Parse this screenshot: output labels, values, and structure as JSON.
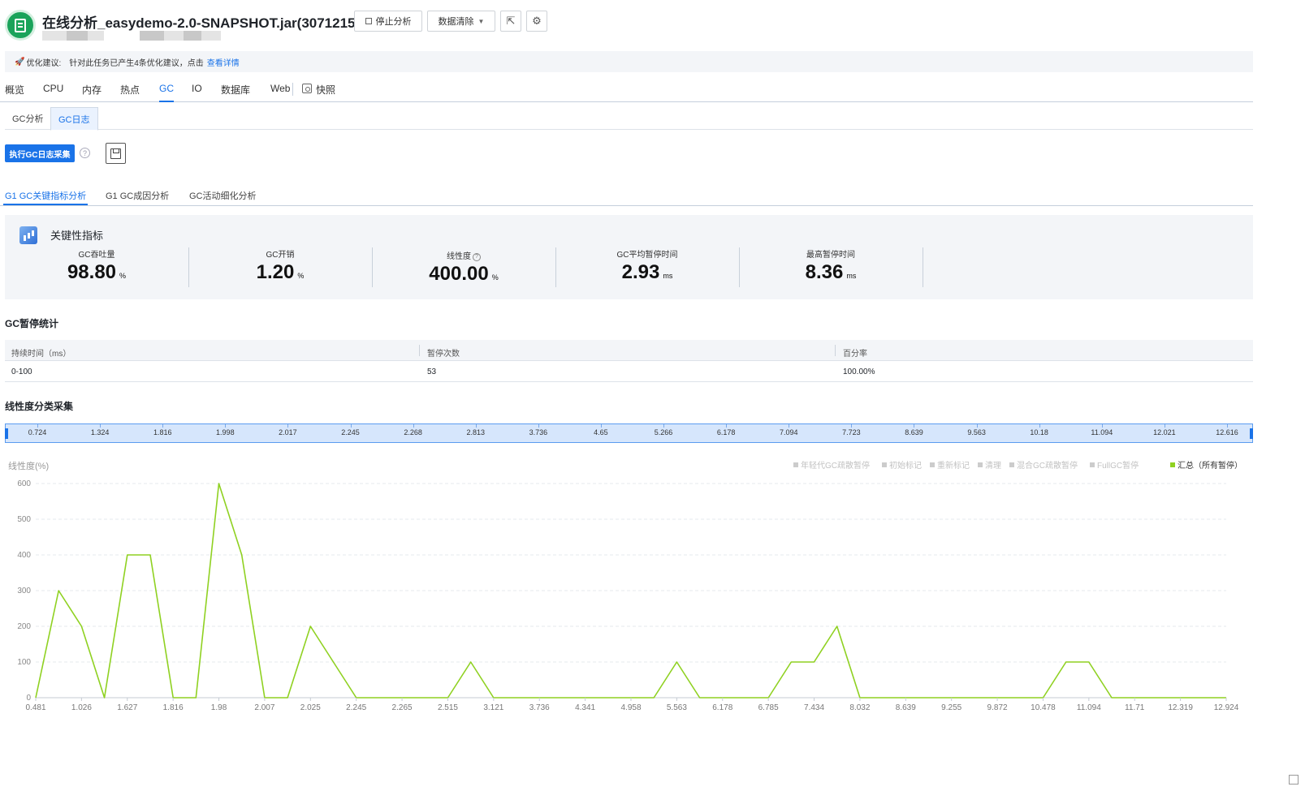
{
  "header": {
    "title": "在线分析_easydemo-2.0-SNAPSHOT.jar(3071215)",
    "stop_label": "停止分析",
    "clean_label": "数据清除",
    "share_icon": "share-icon",
    "tune_icon": "tune-icon"
  },
  "notice": {
    "prefix": "优化建议:",
    "text": "针对此任务已产生4条优化建议，点击",
    "link": "查看详情"
  },
  "main_tabs": [
    {
      "label": "概览"
    },
    {
      "label": "CPU"
    },
    {
      "label": "内存"
    },
    {
      "label": "热点"
    },
    {
      "label": "GC",
      "active": true
    },
    {
      "label": "IO"
    },
    {
      "label": "数据库"
    },
    {
      "label": "Web"
    },
    {
      "label": "快照"
    }
  ],
  "sub_tabs": [
    {
      "label": "GC分析"
    },
    {
      "label": "GC日志",
      "active": true
    }
  ],
  "toolbar": {
    "run_label": "执行GC日志采集",
    "help": "?"
  },
  "analysis_tabs": [
    {
      "label": "G1 GC关键指标分析",
      "active": true
    },
    {
      "label": "G1 GC成因分析"
    },
    {
      "label": "GC活动细化分析"
    }
  ],
  "kpis": {
    "title": "关键性指标",
    "items": [
      {
        "label": "GC吞吐量",
        "value": "98.80",
        "unit": "%"
      },
      {
        "label": "GC开销",
        "value": "1.20",
        "unit": "%"
      },
      {
        "label": "线性度",
        "value": "400.00",
        "unit": "%",
        "help": true
      },
      {
        "label": "GC平均暂停时间",
        "value": "2.93",
        "unit": "ms"
      },
      {
        "label": "最高暂停时间",
        "value": "8.36",
        "unit": "ms"
      }
    ]
  },
  "pause_stats": {
    "title": "GC暂停统计",
    "columns": [
      "持续时间（ms）",
      "暂停次数",
      "百分率"
    ],
    "rows": [
      [
        "0-100",
        "53",
        "100.00%"
      ]
    ]
  },
  "linearity": {
    "title": "线性度分类采集",
    "scrubber_ticks": [
      "0.724",
      "1.324",
      "1.816",
      "1.998",
      "2.017",
      "2.245",
      "2.268",
      "2.813",
      "3.736",
      "4.65",
      "5.266",
      "6.178",
      "7.094",
      "7.723",
      "8.639",
      "9.563",
      "10.18",
      "11.094",
      "12.021",
      "12.616"
    ]
  },
  "chart_data": {
    "type": "line",
    "ylabel": "线性度(%)",
    "ylim": [
      0,
      600
    ],
    "yticks": [
      0,
      100,
      200,
      300,
      400,
      500,
      600
    ],
    "grid": true,
    "legend_position": "top-right",
    "x_tick_labels": [
      "0.481",
      "1.026",
      "1.627",
      "1.816",
      "1.98",
      "2.007",
      "2.025",
      "2.245",
      "2.265",
      "2.515",
      "3.121",
      "3.736",
      "4.341",
      "4.958",
      "5.563",
      "6.178",
      "6.785",
      "7.434",
      "8.032",
      "8.639",
      "9.255",
      "9.872",
      "10.478",
      "11.094",
      "11.71",
      "12.319",
      "12.924"
    ],
    "legend": [
      {
        "name": "年轻代GC疏散暂停",
        "color": "#cccccc"
      },
      {
        "name": "初始标记",
        "color": "#cccccc"
      },
      {
        "name": "重新标记",
        "color": "#cccccc"
      },
      {
        "name": "清理",
        "color": "#cccccc"
      },
      {
        "name": "混合GC疏散暂停",
        "color": "#cccccc"
      },
      {
        "name": "FullGC暂停",
        "color": "#cccccc"
      },
      {
        "name": "汇总（所有暂停）",
        "color": "#8fd121",
        "active": true
      }
    ],
    "series": [
      {
        "name": "汇总（所有暂停）",
        "color": "#8fd121",
        "values": [
          0,
          300,
          200,
          0,
          400,
          400,
          0,
          0,
          600,
          400,
          0,
          0,
          200,
          100,
          0,
          0,
          0,
          0,
          0,
          100,
          0,
          0,
          0,
          0,
          0,
          0,
          0,
          0,
          100,
          0,
          0,
          0,
          0,
          100,
          100,
          200,
          0,
          0,
          0,
          0,
          0,
          0,
          0,
          0,
          0,
          100,
          100,
          0,
          0,
          0,
          0,
          0,
          0
        ]
      }
    ]
  },
  "colors": {
    "accent": "#1a73e8",
    "line": "#8fd121",
    "brand": "#1aa35a"
  }
}
